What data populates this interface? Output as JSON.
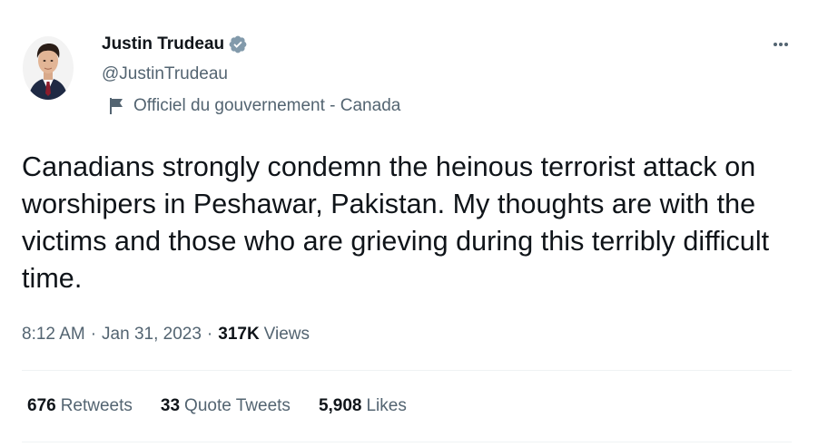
{
  "author": {
    "name": "Justin Trudeau",
    "handle": "@JustinTrudeau",
    "affiliation": "Officiel du gouvernement - Canada",
    "verified_color": "#829aab"
  },
  "tweet": {
    "text": "Canadians strongly condemn the heinous terrorist attack on worshipers in Peshawar, Pakistan. My thoughts are with the victims and those who are grieving during this terribly difficult time.",
    "time": "8:12 AM",
    "separator": "·",
    "date": "Jan 31, 2023",
    "views_count": "317K",
    "views_label": "Views"
  },
  "stats": {
    "retweets_count": "676",
    "retweets_label": "Retweets",
    "quotes_count": "33",
    "quotes_label": "Quote Tweets",
    "likes_count": "5,908",
    "likes_label": "Likes"
  },
  "icons": {
    "verified": "verified-badge-icon",
    "flag": "government-flag-icon",
    "more": "more-options-icon"
  },
  "colors": {
    "primary_text": "#0f1419",
    "secondary_text": "#536471",
    "divider": "#eff3f4"
  }
}
